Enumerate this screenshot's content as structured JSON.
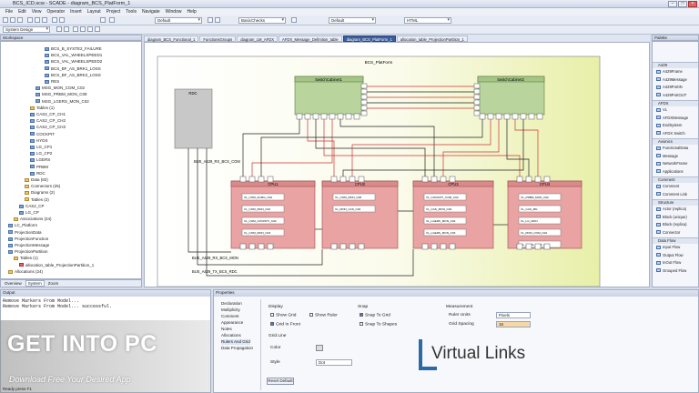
{
  "window": {
    "title": "BCS_ICD.scw - SCADE - diagram_BCS_PlatForm_1"
  },
  "menu": [
    "File",
    "Edit",
    "View",
    "Operator",
    "Insert",
    "Layout",
    "Project",
    "Tools",
    "Navigate",
    "Window",
    "Help"
  ],
  "toolbar": {
    "combo1": "Default",
    "combo2": "BasicChecks",
    "combo3": "Default",
    "combo4": "HTML",
    "design": "System Design"
  },
  "workspace": {
    "title": "Workspace",
    "items": [
      "BCS_B_SYSTE2_FAILURE",
      "BCS_VAL_WHEELSPEED1",
      "BCS_VAL_WHEELSPEED2",
      "BCS_BF_AS_BRK1_LOSS",
      "BCS_BF_AS_BRK2_LOSS",
      "RES",
      "MSG_MON_COM_C02",
      "MSG_PRBM_MON_C08",
      "MSG_LGERS_MON_C02",
      "Tables (1)",
      "CAS2_CP_CH1",
      "CAS2_CP_CH2",
      "CAS2_CP_CH3",
      "COCKPIT",
      "HYDS",
      "LG_CP1",
      "LG_CP2",
      "LGERS",
      "PRBM",
      "RDC",
      "Data (82)",
      "Connectors (25)",
      "Diagrams (2)",
      "Tables (2)",
      "CAS2_CP",
      "LG_CP",
      "Associations (24)",
      "LC_Platform",
      "ProjectionData",
      "ProjectionFunction",
      "ProjectionMessage",
      "ProjectionPartition",
      "Tables (1)",
      "allocation_table_ProjectionPartition_1",
      "Allocations (24)"
    ],
    "tabs": [
      "Overview",
      "System",
      "Zoom"
    ]
  },
  "editor_tabs": [
    "diagram_BCS_Functional_1",
    "FunctionsGroups",
    "diagram_LM_AFDX",
    "AFDX_Message_Definition_table",
    "diagram_BCS_PlatForm_1",
    "allocation_table_ProjectionPartition_1"
  ],
  "diagram": {
    "frame": "BCS_PlatForm",
    "rdc": "RDC",
    "switches": [
      "SwitchCabinet1",
      "SwitchCabinet2"
    ],
    "cpus": [
      {
        "name": "CPU1",
        "vls": [
          "VL_COM_ACMG_C02",
          "VL_COM_MON_C02",
          "VL_COM_COCKPIT_C02",
          "VL_COM_MON_C03"
        ]
      },
      {
        "name": "CPU2",
        "vls": [
          "VL_COM_MON_C08",
          "VL_MON_CAS_C02"
        ]
      },
      {
        "name": "CPU3",
        "vls": [
          "VL_COCKPIT_COM_C02",
          "VL_CAS_MON_C02",
          "VL_LGERS_MON_C02",
          "VL_LGERS_MON_C03"
        ]
      },
      {
        "name": "CPU4",
        "vls": [
          "VL_PRBM_MON_C02",
          "VL_CAS_MN",
          "VL_LG_MON",
          "VL_MON_COM_C02",
          "VL_ARMS_COM_C02"
        ]
      }
    ],
    "labels": [
      "BUS_A429_RX_BCS_COM",
      "BUS_A429_RX_BCS_MON",
      "BUS_A429_TX_BCS_RDC"
    ]
  },
  "palette": {
    "title": "Palette",
    "sections": [
      {
        "name": "A429",
        "items": [
          "A429Frame",
          "A429Message",
          "A429PortIN",
          "A429PortOUT"
        ]
      },
      {
        "name": "AFDX",
        "items": [
          "VL",
          "AFDXMessage",
          "EndSystem",
          "AFDX Switch"
        ]
      },
      {
        "name": "Avionics",
        "items": [
          "FunctionalData",
          "Message",
          "NetworkFrame",
          "Applications"
        ]
      },
      {
        "name": "Comment",
        "items": [
          "Comment",
          "Comment Link"
        ]
      },
      {
        "name": "Structure",
        "items": [
          "Actor (replica)",
          "Block (unique)",
          "Block (replica)",
          "Connector"
        ]
      },
      {
        "name": "Data Flow",
        "items": [
          "Input Flow",
          "Output Flow",
          "InOut Flow",
          "Grouped Flow"
        ]
      }
    ]
  },
  "output": {
    "title": "Output",
    "lines": [
      "Remove Markers From Model...",
      "Remove Markers From Model... successful."
    ]
  },
  "properties": {
    "title": "Properties",
    "categories": [
      "Declaration",
      "Multiplicity",
      "Comment",
      "Appearance",
      "Notes",
      "Allocations",
      "Rulers And Grid",
      "Data Propagation"
    ],
    "display": "Display",
    "show_grid": "Show Grid",
    "show_ruler": "Show Ruler",
    "grid_in_front": "Grid In Front",
    "snap": "Snap",
    "snap_to_grid": "Snap To Grid",
    "snap_to_shapes": "Snap To Shapes",
    "measurement": "Measurement",
    "ruler_units": "Ruler Units",
    "ruler_units_value": "Pixels",
    "grid_spacing": "Grid Spacing",
    "grid_spacing_value": "16",
    "grid_line": "Grid Line",
    "color": "Color",
    "style": "Style",
    "style_value": "Dot",
    "reset": "Reset Default"
  },
  "watermark": {
    "brand": "GET INTO PC",
    "tagline": "Download Free Your Desired App",
    "logo": "Virtual Links"
  },
  "status": "Ready  press F1"
}
